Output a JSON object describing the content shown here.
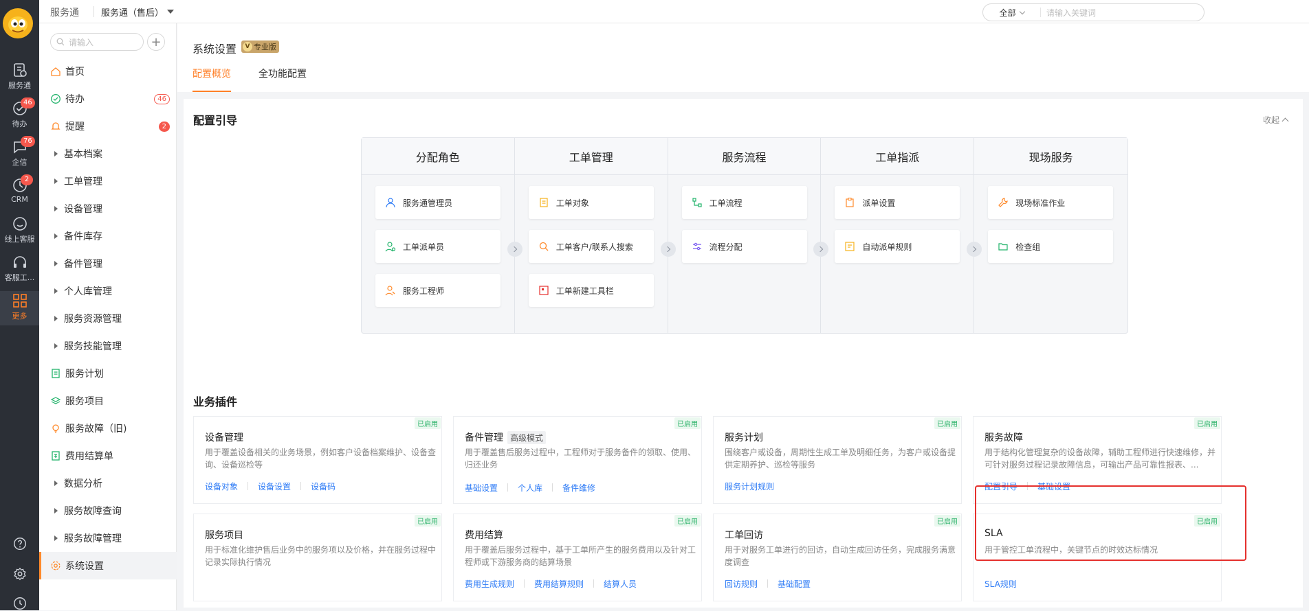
{
  "topbar": {
    "brand": "服务通",
    "app_select": "服务通（售后）",
    "search_scope": "全部",
    "search_placeholder": "请输入关键词"
  },
  "rail": {
    "items": [
      {
        "label": "服务通",
        "icon": "service-icon",
        "badge": ""
      },
      {
        "label": "待办",
        "icon": "todo-icon",
        "badge": "46"
      },
      {
        "label": "企信",
        "icon": "chat-icon",
        "badge": "76"
      },
      {
        "label": "CRM",
        "icon": "crm-icon",
        "badge": "2"
      },
      {
        "label": "线上客服",
        "icon": "online-service-icon",
        "badge": ""
      },
      {
        "label": "客服工...",
        "icon": "headset-icon",
        "badge": ""
      },
      {
        "label": "更多",
        "icon": "more-grid-icon",
        "badge": ""
      }
    ]
  },
  "sidebar": {
    "search_placeholder": "请输入",
    "items": [
      {
        "label": "首页",
        "icon": "home-icon",
        "count": ""
      },
      {
        "label": "待办",
        "icon": "check-circle-icon",
        "count": "46"
      },
      {
        "label": "提醒",
        "icon": "bell-icon",
        "count": "2"
      },
      {
        "label": "基本档案",
        "icon": "expand-icon",
        "count": ""
      },
      {
        "label": "工单管理",
        "icon": "expand-icon",
        "count": ""
      },
      {
        "label": "设备管理",
        "icon": "expand-icon",
        "count": ""
      },
      {
        "label": "备件库存",
        "icon": "expand-icon",
        "count": ""
      },
      {
        "label": "备件管理",
        "icon": "expand-icon",
        "count": ""
      },
      {
        "label": "个人库管理",
        "icon": "expand-icon",
        "count": ""
      },
      {
        "label": "服务资源管理",
        "icon": "expand-icon",
        "count": ""
      },
      {
        "label": "服务技能管理",
        "icon": "expand-icon",
        "count": ""
      },
      {
        "label": "服务计划",
        "icon": "plan-icon",
        "count": ""
      },
      {
        "label": "服务项目",
        "icon": "layers-icon",
        "count": ""
      },
      {
        "label": "服务故障（旧)",
        "icon": "bulb-icon",
        "count": ""
      },
      {
        "label": "费用结算单",
        "icon": "receipt-icon",
        "count": ""
      },
      {
        "label": "数据分析",
        "icon": "expand-icon",
        "count": ""
      },
      {
        "label": "服务故障查询",
        "icon": "expand-icon",
        "count": ""
      },
      {
        "label": "服务故障管理",
        "icon": "expand-icon",
        "count": ""
      },
      {
        "label": "系统设置",
        "icon": "gear-icon",
        "count": ""
      }
    ]
  },
  "main": {
    "title": "系统设置",
    "pro_badge": "专业版",
    "pro_badge_letter": "V",
    "tabs": [
      {
        "label": "配置概览",
        "active": true
      },
      {
        "label": "全功能配置",
        "active": false
      }
    ],
    "guide": {
      "title": "配置引导",
      "collapse": "收起",
      "columns": [
        {
          "title": "分配角色",
          "items": [
            "服务通管理员",
            "工单派单员",
            "服务工程师"
          ]
        },
        {
          "title": "工单管理",
          "items": [
            "工单对象",
            "工单客户/联系人搜索",
            "工单新建工具栏"
          ]
        },
        {
          "title": "服务流程",
          "items": [
            "工单流程",
            "流程分配"
          ]
        },
        {
          "title": "工单指派",
          "items": [
            "派单设置",
            "自动派单规则"
          ]
        },
        {
          "title": "现场服务",
          "items": [
            "现场标准作业",
            "检查组"
          ]
        }
      ]
    },
    "plugins": {
      "title": "业务插件",
      "enabled_label": "已启用",
      "cards": [
        {
          "title": "设备管理",
          "tag": "",
          "desc": "用于覆盖设备相关的业务场景，例如客户设备档案维护、设备查询、设备巡检等",
          "links": [
            "设备对象",
            "设备设置",
            "设备码"
          ]
        },
        {
          "title": "备件管理",
          "tag": "高级模式",
          "desc": "用于覆盖售后服务过程中，工程师对于服务备件的领取、使用、归还业务",
          "links": [
            "基础设置",
            "个人库",
            "备件维修"
          ]
        },
        {
          "title": "服务计划",
          "tag": "",
          "desc": "围绕客户或设备，周期性生成工单及明细任务，为客户或设备提供定期养护、巡检等服务",
          "links": [
            "服务计划规则"
          ]
        },
        {
          "title": "服务故障",
          "tag": "",
          "desc": "用于结构化管理复杂的设备故障，辅助工程师进行快速维修，并可针对服务过程记录故障信息，可输出产品可靠性报表、...",
          "links": [
            "配置引导",
            "基础设置"
          ]
        },
        {
          "title": "服务项目",
          "tag": "",
          "desc": "用于标准化维护售后业务中的服务项以及价格，并在服务过程中记录实际执行情况",
          "links": []
        },
        {
          "title": "费用结算",
          "tag": "",
          "desc": "用于覆盖后服务过程中，基于工单所产生的服务费用以及针对工程师或下游服务商的结算场景",
          "links": [
            "费用生成规则",
            "费用结算规则",
            "结算人员"
          ]
        },
        {
          "title": "工单回访",
          "tag": "",
          "desc": "用于对服务工单进行的回访，自动生成回访任务，完成服务满意度调查",
          "links": [
            "回访规则",
            "基础配置"
          ]
        },
        {
          "title": "SLA",
          "tag": "",
          "desc": "用于管控工单流程中，关键节点的时效达标情况",
          "links": [
            "SLA规则"
          ]
        }
      ]
    }
  },
  "colors": {
    "accent": "#ff7f27",
    "link": "#2f7cf6",
    "enabled_green": "#2fb36b",
    "badge_red": "#f5584d",
    "highlight_red": "#e5302d"
  }
}
